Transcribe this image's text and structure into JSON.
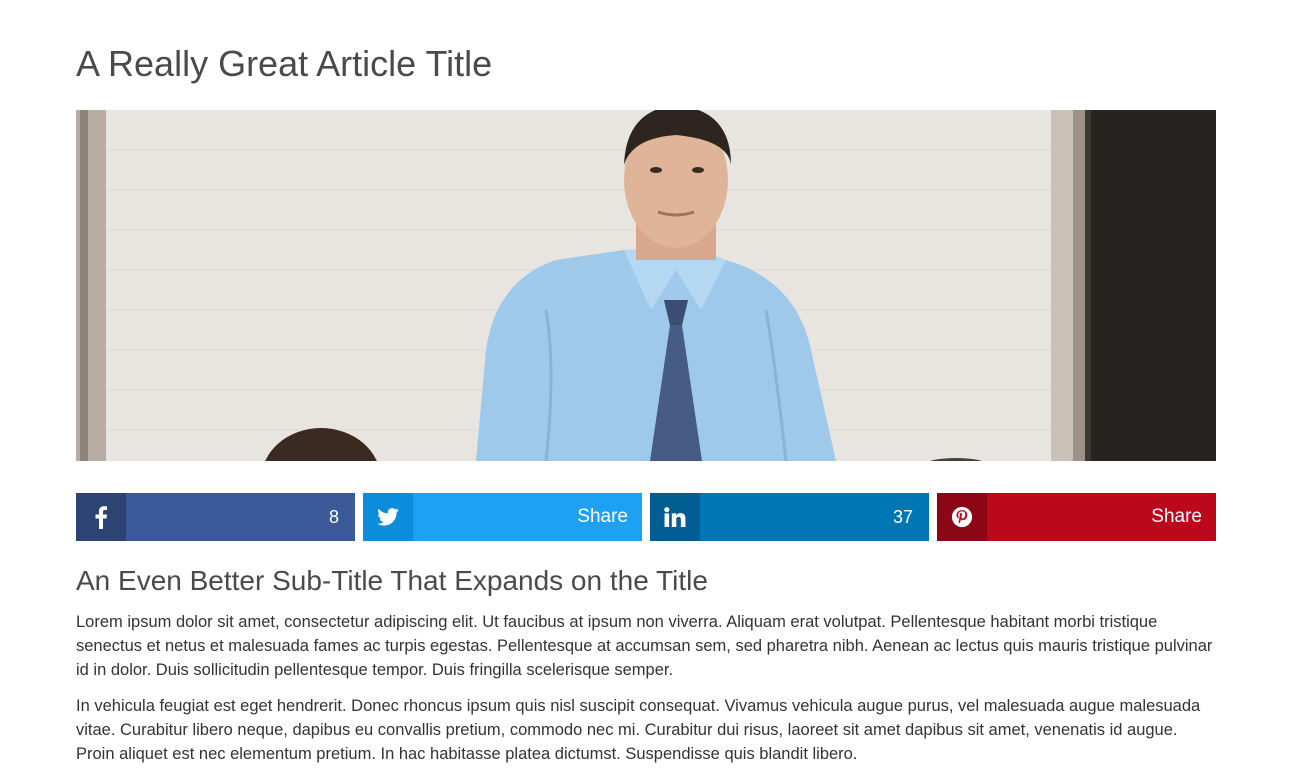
{
  "article": {
    "title": "A Really Great Article Title",
    "subtitle": "An Even Better Sub-Title That Expands on the Title",
    "paragraphs": [
      "Lorem ipsum dolor sit amet, consectetur adipiscing elit. Ut faucibus at ipsum non viverra. Aliquam erat volutpat. Pellentesque habitant morbi tristique senectus et netus et malesuada fames ac turpis egestas. Pellentesque at accumsan sem, sed pharetra nibh. Aenean ac lectus quis mauris tristique pulvinar id in dolor. Duis sollicitudin pellentesque tempor. Duis fringilla scelerisque semper.",
      "In vehicula feugiat est eget hendrerit. Donec rhoncus ipsum quis nisl suscipit consequat. Vivamus vehicula augue purus, vel malesuada augue malesuada vitae. Curabitur libero neque, dapibus eu convallis pretium, commodo nec mi. Curabitur dui risus, laoreet sit amet dapibus sit amet, venenatis id augue. Proin aliquet est nec elementum pretium. In hac habitasse platea dictumst. Suspendisse quis blandit libero."
    ]
  },
  "share": {
    "facebook": {
      "icon": "facebook-icon",
      "label": "8",
      "color": "#3b5998"
    },
    "twitter": {
      "icon": "twitter-icon",
      "label": "Share",
      "color": "#1da1f2"
    },
    "linkedin": {
      "icon": "linkedin-icon",
      "label": "37",
      "color": "#0077b5"
    },
    "pinterest": {
      "icon": "pinterest-icon",
      "label": "Share",
      "color": "#bd081c"
    }
  }
}
